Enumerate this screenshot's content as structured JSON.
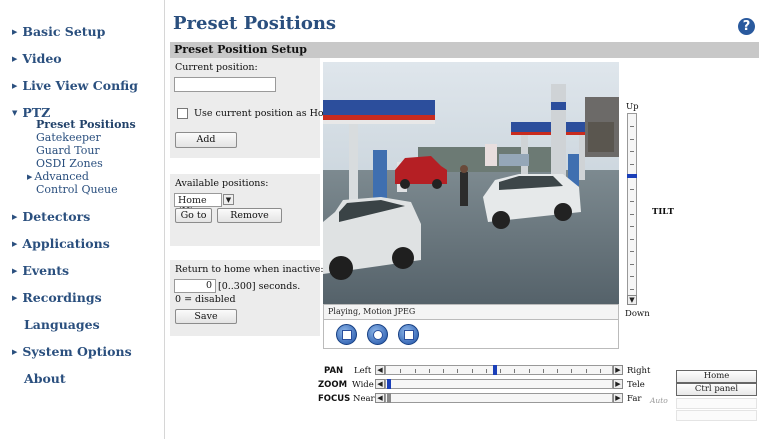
{
  "sidebar": {
    "items": [
      {
        "label": "Basic Setup"
      },
      {
        "label": "Video"
      },
      {
        "label": "Live View Config"
      },
      {
        "label": "PTZ"
      },
      {
        "label": "Detectors"
      },
      {
        "label": "Applications"
      },
      {
        "label": "Events"
      },
      {
        "label": "Recordings"
      },
      {
        "label": "Languages"
      },
      {
        "label": "System Options"
      },
      {
        "label": "About"
      }
    ],
    "ptz_sub": [
      {
        "label": "Preset Positions"
      },
      {
        "label": "Gatekeeper"
      },
      {
        "label": "Guard Tour"
      },
      {
        "label": "OSDI Zones"
      },
      {
        "label": "Advanced"
      },
      {
        "label": "Control Queue"
      }
    ]
  },
  "header": {
    "title": "Preset Positions",
    "help_icon": "?"
  },
  "section": {
    "title": "Preset Position Setup"
  },
  "current": {
    "label": "Current position:",
    "value": "",
    "use_home_label": "Use current position as Home",
    "use_home_checked": false,
    "add_label": "Add"
  },
  "available": {
    "label": "Available positions:",
    "selected": "Home (H)",
    "goto_label": "Go to",
    "remove_label": "Remove"
  },
  "return_home": {
    "label": "Return to home when inactive:",
    "value": "0",
    "range_text": "[0..300] seconds.",
    "hint": "0 = disabled",
    "save_label": "Save"
  },
  "video": {
    "status": "Playing, Motion JPEG",
    "buttons": [
      "stop-icon",
      "snapshot-icon",
      "fullscreen-icon"
    ]
  },
  "tilt": {
    "up": "Up",
    "down": "Down",
    "label": "TILT",
    "level": 0.3
  },
  "pan": {
    "label": "PAN",
    "left": "Left",
    "right": "Right",
    "level": 0.48
  },
  "zoom": {
    "label": "ZOOM",
    "left": "Wide",
    "right": "Tele",
    "level": 0.0
  },
  "focus": {
    "label": "FOCUS",
    "left": "Near",
    "right": "Far",
    "auto": "Auto",
    "level": 0.0
  },
  "side_buttons": {
    "home": "Home",
    "ctrl_panel": "Ctrl panel"
  },
  "colors": {
    "nav": "#2a4f7e",
    "section_bar": "#c8c8c8",
    "panel": "#ececec",
    "accent": "#1a3fb8"
  }
}
